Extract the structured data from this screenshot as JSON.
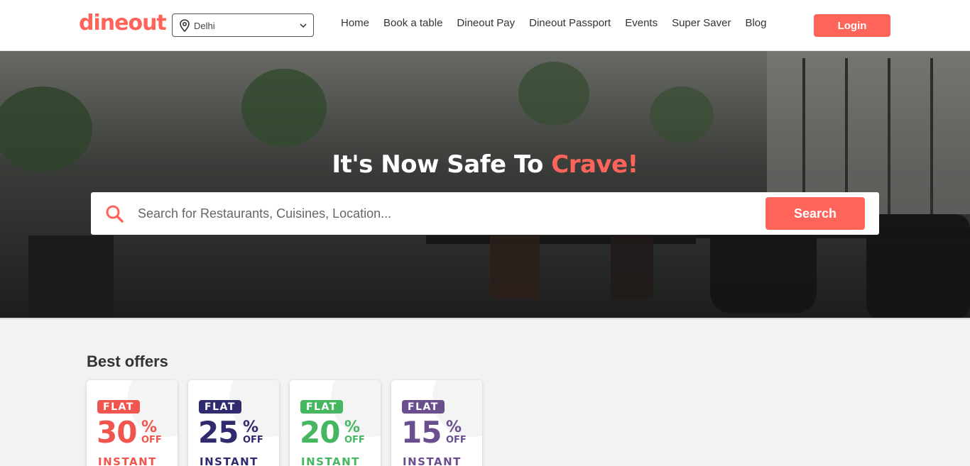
{
  "header": {
    "logo": "dineout",
    "city": "Delhi",
    "nav": [
      "Home",
      "Book a table",
      "Dineout Pay",
      "Dineout Passport",
      "Events",
      "Super Saver",
      "Blog"
    ],
    "login_label": "Login"
  },
  "hero": {
    "title_main": "It's Now Safe To ",
    "title_accent": "Crave!",
    "search_placeholder": "Search for Restaurants, Cuisines, Location...",
    "search_button": "Search"
  },
  "offers": {
    "title": "Best offers",
    "cards": [
      {
        "tag": "FLAT",
        "percent": "30",
        "sign": "%",
        "off": "OFF",
        "label": "INSTANT",
        "color": "#f0564e"
      },
      {
        "tag": "FLAT",
        "percent": "25",
        "sign": "%",
        "off": "OFF",
        "label": "INSTANT",
        "color": "#302a6e"
      },
      {
        "tag": "FLAT",
        "percent": "20",
        "sign": "%",
        "off": "OFF",
        "label": "INSTANT",
        "color": "#46b661"
      },
      {
        "tag": "FLAT",
        "percent": "15",
        "sign": "%",
        "off": "OFF",
        "label": "INSTANT",
        "color": "#6a4f8e"
      }
    ]
  },
  "colors": {
    "brand": "#ff645a",
    "background": "#f2f2f2"
  },
  "icons": {
    "location": "map-pin-icon",
    "dropdown": "chevron-down-icon",
    "search": "search-icon"
  }
}
